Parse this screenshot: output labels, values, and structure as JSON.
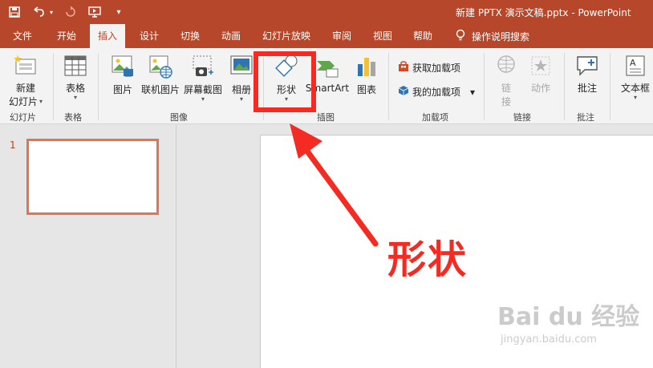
{
  "titlebar": {
    "title": "新建 PPTX 演示文稿.pptx  -  PowerPoint",
    "qat": [
      "save-icon",
      "undo-icon",
      "redo-icon",
      "present-from-start-icon",
      "customize-qat-icon"
    ]
  },
  "tabs": [
    "文件",
    "开始",
    "插入",
    "设计",
    "切换",
    "动画",
    "幻灯片放映",
    "审阅",
    "视图",
    "帮助"
  ],
  "active_tab": "插入",
  "tell_me": "操作说明搜索",
  "ribbon": {
    "new_slide": "新建\n幻灯片",
    "new_slide_line1": "新建",
    "new_slide_line2": "幻灯片",
    "table": "表格",
    "picture": "图片",
    "online_picture": "联机图片",
    "screenshot": "屏幕截图",
    "album": "相册",
    "shapes": "形状",
    "smartart": "SmartArt",
    "chart": "图表",
    "get_addins": "获取加载项",
    "my_addins": "我的加载项",
    "link": "链\n接",
    "link_line1": "链",
    "link_line2": "接",
    "action": "动作",
    "comment": "批注",
    "textbox": "文本框",
    "groups": {
      "slides": "幻灯片",
      "tables": "表格",
      "images": "图像",
      "illustrations": "插图",
      "addins": "加载项",
      "links": "链接",
      "comments": "批注"
    }
  },
  "slides_pane": {
    "slide_number": "1"
  },
  "annotation": {
    "text": "形状"
  },
  "watermark": {
    "logo": "Bai du 经验",
    "url": "jingyan.baidu.com"
  },
  "colors": {
    "accent": "#b7472a",
    "highlight": "#f32b23",
    "thumb_border": "#e2754f"
  }
}
